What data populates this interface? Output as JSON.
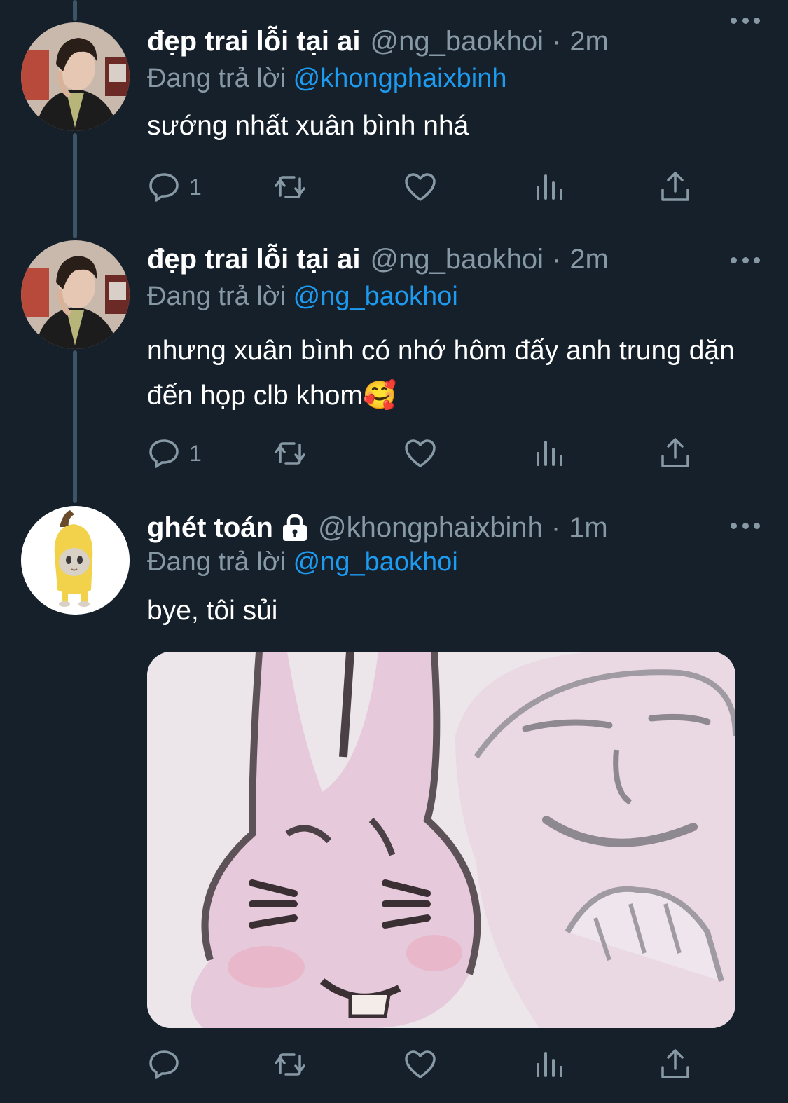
{
  "tweets": [
    {
      "display_name": "đẹp trai lỗi tại ai",
      "handle": "@ng_baokhoi",
      "separator": "·",
      "time": "2m",
      "reply_prefix": "Đang trả lời",
      "reply_to": "@khongphaixbinh",
      "text": "sướng nhất xuân bình nhá",
      "reply_count": "1",
      "avatar": "portrait-boy-avatar"
    },
    {
      "display_name": "đẹp trai lỗi tại ai",
      "handle": "@ng_baokhoi",
      "separator": "·",
      "time": "2m",
      "reply_prefix": "Đang trả lời",
      "reply_to": "@ng_baokhoi",
      "text": "nhưng xuân bình có nhớ hôm đấy anh trung dặn đến họp clb khom🥰",
      "reply_count": "1",
      "avatar": "portrait-boy-avatar"
    },
    {
      "display_name": "ghét toán",
      "protected": true,
      "handle": "@khongphaixbinh",
      "separator": "·",
      "time": "1m",
      "reply_prefix": "Đang trả lời",
      "reply_to": "@ng_baokhoi",
      "text": "bye, tôi sủi",
      "reply_count": "",
      "avatar": "banana-cat-avatar",
      "media": "bunny-and-face-meme-image"
    }
  ],
  "colors": {
    "background": "#15202b",
    "text_primary": "#ffffff",
    "text_secondary": "#8899a6",
    "mention": "#1d9bf0",
    "thread_line": "#3d5466"
  },
  "icons": [
    "reply-icon",
    "retweet-icon",
    "like-icon",
    "analytics-icon",
    "share-icon",
    "more-icon",
    "lock-icon"
  ]
}
